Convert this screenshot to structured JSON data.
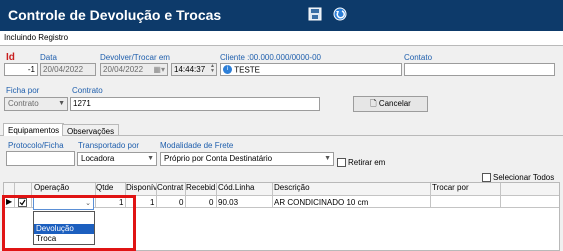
{
  "window": {
    "title": "Controle de Devolução e Trocas",
    "mode": "Incluindo Registro"
  },
  "header": {
    "id_label": "Id",
    "id_value": "-1",
    "data_label": "Data",
    "data_value": "20/04/2022",
    "devolver_label": "Devolver/Trocar em",
    "devolver_date": "20/04/2022",
    "devolver_time": "14:44:37",
    "cliente_label": "Cliente :00.000.000/0000-00",
    "cliente_value": "TESTE",
    "contato_label": "Contato",
    "contato_value": ""
  },
  "ficha": {
    "ficha_label": "Ficha por",
    "ficha_value": "Contrato",
    "contrato_label": "Contrato",
    "contrato_value": "1271",
    "cancel_label": "Cancelar"
  },
  "tabs": [
    {
      "label": "Equipamentos"
    },
    {
      "label": "Observações"
    }
  ],
  "equip": {
    "protocolo_label": "Protocolo/Ficha",
    "protocolo_value": "",
    "transportado_label": "Transportado por",
    "transportado_value": "Locadora",
    "modalidade_label": "Modalidade de Frete",
    "modalidade_value": "Próprio por Conta Destinatário",
    "retirar_label": "Retirar em",
    "selecionar_label": "Selecionar Todos"
  },
  "table": {
    "columns": [
      "Operação",
      "Qtde",
      "Disponív",
      "Contrat",
      "Recebid",
      "Cód.Linha",
      "Descrição",
      "Trocar por"
    ],
    "row": {
      "qtde": "1",
      "disponivel": "1",
      "contrat": "0",
      "recebido": "0",
      "cod_linha": "90.03",
      "descricao": "AR CONDICINADO 10 cm",
      "trocar": ""
    }
  },
  "dropdown": {
    "options": [
      "Devolução",
      "Troca"
    ]
  },
  "colors": {
    "titlebar": "#0d3a6a",
    "highlight": "#e01414",
    "label_blue": "#1f5fad"
  }
}
